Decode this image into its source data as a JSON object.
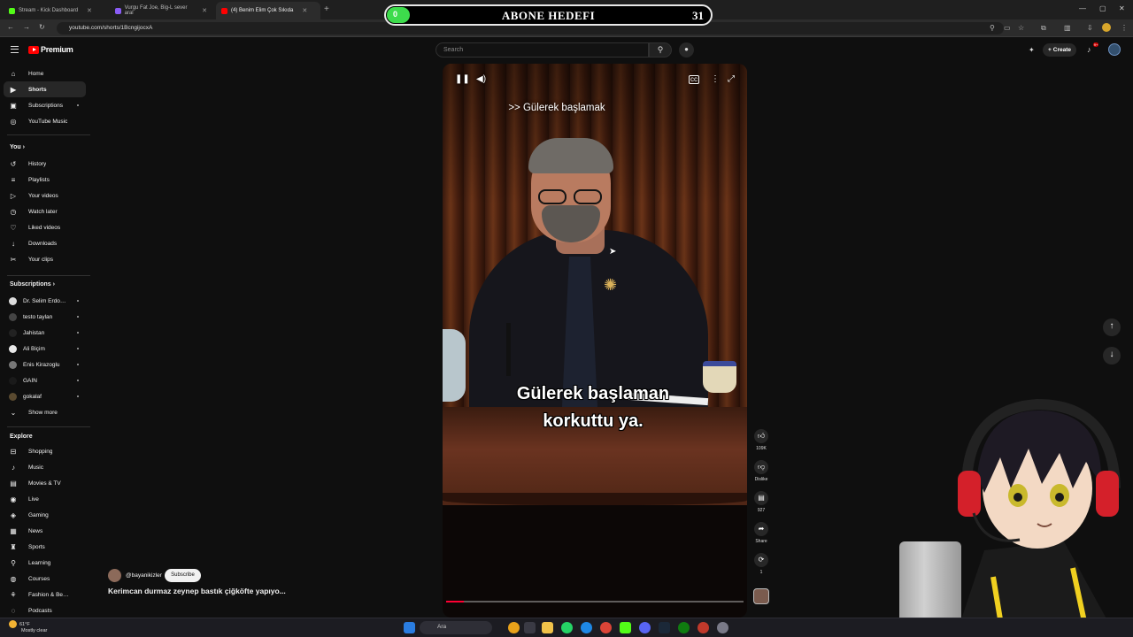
{
  "browser": {
    "tabs": [
      {
        "label": "Stream - Kick Dashboard",
        "color": "#53fc18"
      },
      {
        "label": "Vurgu Fat Joe, Big-L sever aral",
        "color": "#8a5cf5"
      },
      {
        "label": "(4) Benim Elim Çok Sıkıda",
        "color": "#ff0000"
      }
    ],
    "url": "youtube.com/shorts/1BcngijocxA"
  },
  "goal": {
    "title": "ABONE HEDEFI",
    "current": "0",
    "target": "31",
    "progress_fraction": 0
  },
  "header": {
    "logo_text": "Premium",
    "search_placeholder": "Search",
    "create_label": "Create",
    "notif_count": "9+"
  },
  "sidebar": {
    "main": [
      {
        "label": "Home",
        "icon": "home-icon",
        "glyph": "⌂"
      },
      {
        "label": "Shorts",
        "icon": "shorts-icon",
        "glyph": "▶"
      },
      {
        "label": "Subscriptions",
        "icon": "subscriptions-icon",
        "glyph": "▣"
      },
      {
        "label": "YouTube Music",
        "icon": "music-icon",
        "glyph": "◎"
      }
    ],
    "you_title": "You",
    "you": [
      {
        "label": "History",
        "icon": "history-icon",
        "glyph": "↺"
      },
      {
        "label": "Playlists",
        "icon": "playlists-icon",
        "glyph": "≡"
      },
      {
        "label": "Your videos",
        "icon": "your-videos-icon",
        "glyph": "▷"
      },
      {
        "label": "Watch later",
        "icon": "clock-icon",
        "glyph": "◷"
      },
      {
        "label": "Liked videos",
        "icon": "like-icon",
        "glyph": "♡"
      },
      {
        "label": "Downloads",
        "icon": "download-icon",
        "glyph": "↓"
      },
      {
        "label": "Your clips",
        "icon": "scissors-icon",
        "glyph": "✂"
      }
    ],
    "subs_title": "Subscriptions",
    "subs": [
      {
        "label": "Dr. Selim Erdoğa...",
        "color": "#dddddd"
      },
      {
        "label": "testo taylan",
        "color": "#444444"
      },
      {
        "label": "Jahistan",
        "color": "#222222"
      },
      {
        "label": "Ali Biçim",
        "color": "#e8e8e8"
      },
      {
        "label": "Enis Kirazoglu",
        "color": "#777777"
      },
      {
        "label": "GAİN",
        "color": "#1a1a1a"
      },
      {
        "label": "gokalaf",
        "color": "#5a4a30"
      }
    ],
    "show_more": "Show more",
    "explore_title": "Explore",
    "explore": [
      {
        "label": "Shopping",
        "icon": "shopping-icon",
        "glyph": "⊟"
      },
      {
        "label": "Music",
        "icon": "music-note-icon",
        "glyph": "♪"
      },
      {
        "label": "Movies & TV",
        "icon": "movies-icon",
        "glyph": "▤"
      },
      {
        "label": "Live",
        "icon": "live-icon",
        "glyph": "◉"
      },
      {
        "label": "Gaming",
        "icon": "gaming-icon",
        "glyph": "◈"
      },
      {
        "label": "News",
        "icon": "news-icon",
        "glyph": "▦"
      },
      {
        "label": "Sports",
        "icon": "trophy-icon",
        "glyph": "♜"
      },
      {
        "label": "Learning",
        "icon": "learning-icon",
        "glyph": "⚲"
      },
      {
        "label": "Courses",
        "icon": "courses-icon",
        "glyph": "◍"
      },
      {
        "label": "Fashion & Beauty",
        "icon": "fashion-icon",
        "glyph": "⚘"
      },
      {
        "label": "Podcasts",
        "icon": "podcast-icon",
        "glyph": "◌"
      }
    ]
  },
  "video": {
    "caption_top": ">> Gülerek başlamak",
    "caption_line1": "Gülerek başlaman",
    "caption_line2": "korkuttu ya.",
    "progress_fraction": 0.06
  },
  "actions": {
    "likes": "109K",
    "dislike_label": "Dislike",
    "comments": "927",
    "share_label": "Share",
    "remix_count": "1"
  },
  "channel": {
    "name": "@bayanikizler",
    "subscribe_label": "Subscribe",
    "video_title": "Kerimcan durmaz zeynep bastık çiğköfte yapıyo..."
  },
  "taskbar": {
    "temp": "61°F",
    "weather": "Mostly clear",
    "search_label": "Ara"
  }
}
